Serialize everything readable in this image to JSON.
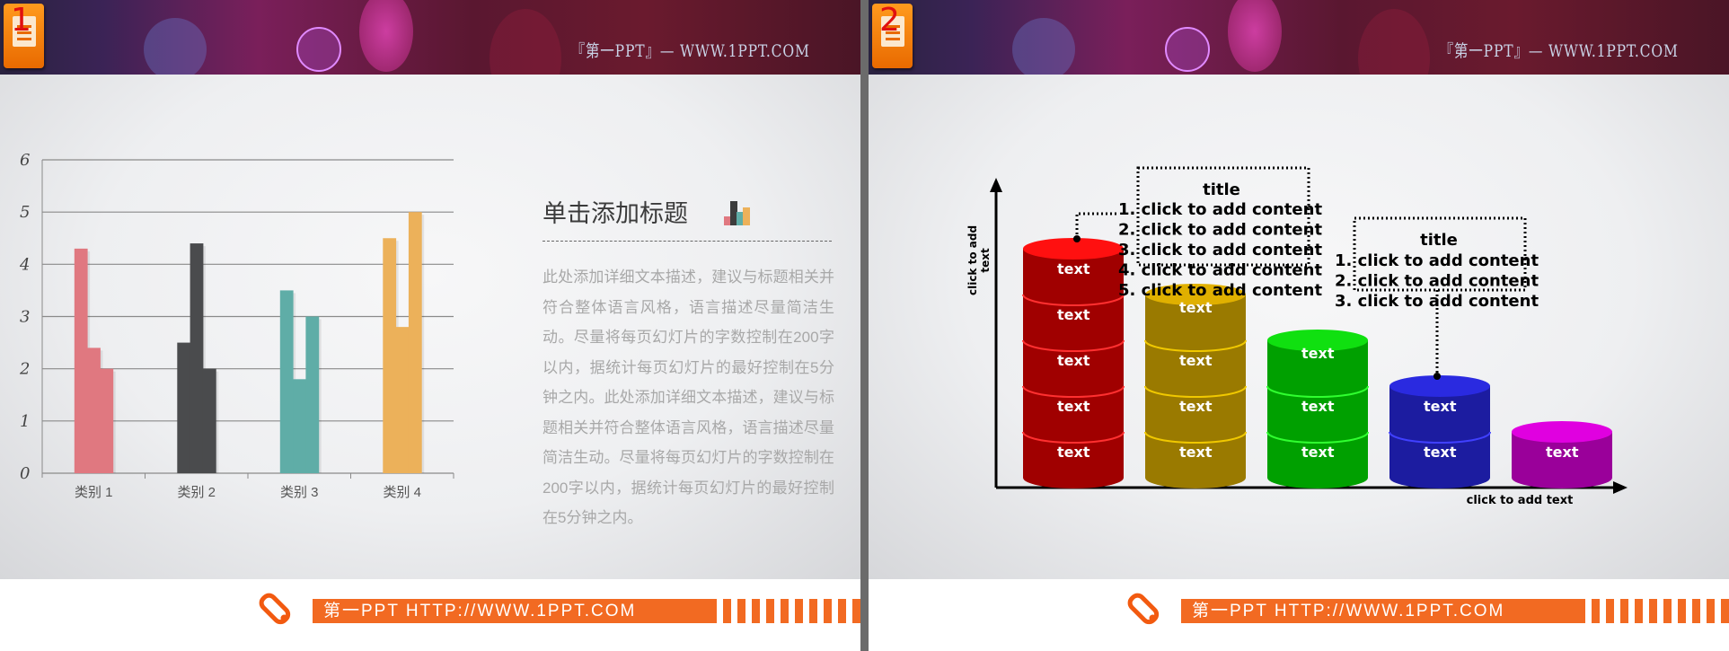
{
  "slides": [
    {
      "number": "1",
      "header_text": "『第一PPT』— WWW.1PPT.COM",
      "footer_text": "第一PPT HTTP://WWW.1PPT.COM",
      "title": "单击添加标题",
      "paragraph": "此处添加详细文本描述，建议与标题相关并符合整体语言风格，语言描述尽量简洁生动。尽量将每页幻灯片的字数控制在200字以内，据统计每页幻灯片的最好控制在5分钟之内。此处添加详细文本描述，建议与标题相关并符合整体语言风格，语言描述尽量简洁生动。尽量将每页幻灯片的字数控制在200字以内，据统计每页幻灯片的最好控制在5分钟之内。",
      "title_icon": "bar-chart-icon"
    },
    {
      "number": "2",
      "header_text": "『第一PPT』— WWW.1PPT.COM",
      "footer_text": "第一PPT HTTP://WWW.1PPT.COM",
      "y_axis_label": "click to add text",
      "x_axis_label": "click to add text",
      "stacks": [
        {
          "segments": 5,
          "label": "text",
          "color": "#a00000"
        },
        {
          "segments": 4,
          "label": "text",
          "color": "#9a7a00"
        },
        {
          "segments": 3,
          "label": "text",
          "color": "#00a000"
        },
        {
          "segments": 2,
          "label": "text",
          "color": "#1c1ca0"
        },
        {
          "segments": 1,
          "label": "text",
          "color": "#9a009a"
        }
      ],
      "callouts": [
        {
          "title": "title",
          "items": [
            "1. click to add content",
            "2. click to add content",
            "3. click to add content",
            "4. click to add content",
            "5. click to add content"
          ]
        },
        {
          "title": "title",
          "items": [
            "1. click to add content",
            "2. click to add content",
            "3. click to add content"
          ]
        }
      ]
    }
  ],
  "chart_data": {
    "type": "bar",
    "categories": [
      "类别 1",
      "类别 2",
      "类别 3",
      "类别 4"
    ],
    "series": [
      {
        "values": [
          4.3,
          2.5,
          3.5,
          4.5
        ]
      },
      {
        "values": [
          2.4,
          4.4,
          1.8,
          2.8
        ]
      },
      {
        "values": [
          2.0,
          2.0,
          3.0,
          5.0
        ]
      }
    ],
    "category_colors": [
      "#e07880",
      "#4a4b4d",
      "#5fada7",
      "#ecb15a"
    ],
    "yticks": [
      "0",
      "1",
      "2",
      "3",
      "4",
      "5",
      "6"
    ],
    "ylim": [
      0,
      6
    ],
    "grid": true
  }
}
